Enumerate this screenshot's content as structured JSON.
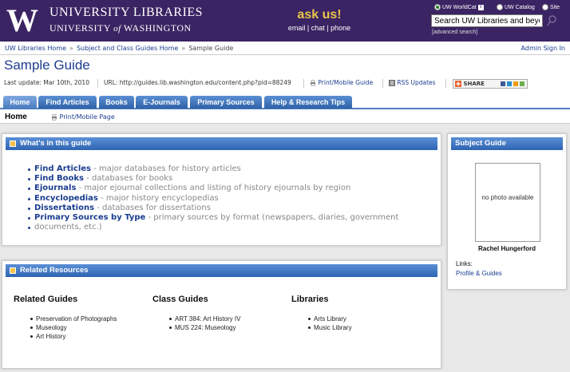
{
  "header": {
    "logo_letter": "W",
    "library_name": "UNIVERSITY LIBRARIES",
    "university_prefix": "UNIVERSITY",
    "university_of": "of",
    "university_suffix": "WASHINGTON",
    "ask_us": "ask us!",
    "ask_links": "email | chat | phone",
    "search_scopes": [
      {
        "label": "UW WorldCat",
        "selected": true
      },
      {
        "label": "UW Catalog",
        "selected": false
      },
      {
        "label": "Site",
        "selected": false
      }
    ],
    "info_badge": "i",
    "search_value": "Search UW Libraries and beyond",
    "advanced_search": "[advanced search]"
  },
  "breadcrumb": {
    "items": [
      "UW Libraries Home",
      "Subject and Class Guides Home",
      "Sample Guide"
    ],
    "separator": "»",
    "admin": "Admin Sign In"
  },
  "page": {
    "title": "Sample Guide",
    "last_update": "Last update: Mar 10th, 2010",
    "url": "URL: http://guides.lib.washington.edu/content.php?pid=88249",
    "print_mobile": "Print/Mobile Guide",
    "rss": "RSS Updates",
    "share": "SHARE"
  },
  "tabs": [
    {
      "label": "Home",
      "active": true
    },
    {
      "label": "Find Articles",
      "active": false
    },
    {
      "label": "Books",
      "active": false
    },
    {
      "label": "E-Journals",
      "active": false
    },
    {
      "label": "Primary Sources",
      "active": false
    },
    {
      "label": "Help & Research Tips",
      "active": false
    }
  ],
  "subbar": {
    "current": "Home",
    "print": "Print/Mobile Page"
  },
  "whats_in": {
    "title": "What's in this guide",
    "items": [
      {
        "link": "Find Articles",
        "desc": " -  major databases for history articles"
      },
      {
        "link": "Find Books",
        "desc": " -  databases for books"
      },
      {
        "link": "Ejournals",
        "desc": " - major ejournal collections and listing of history ejournals by region"
      },
      {
        "link": "Encyclopedias",
        "desc": " - major history encyclopedias"
      },
      {
        "link": "Dissertations",
        "desc": " - databases for dissertations"
      },
      {
        "link": "Primary Sources by Type",
        "desc": " - primary sources by format (newspapers, diaries, government"
      },
      {
        "link": "",
        "desc": "documents, etc.)"
      }
    ]
  },
  "related": {
    "title": "Related Resources",
    "guides_title": "Related Guides",
    "guides": [
      "Preservation of Photographs",
      "Museology",
      "Art History"
    ],
    "class_title": "Class Guides",
    "class_guides": [
      "ART 384: Art History IV",
      "MUS 224: Museology"
    ],
    "libraries_title": "Libraries",
    "libraries": [
      "Arts Library",
      "Music Library"
    ]
  },
  "subject_guide": {
    "title": "Subject Guide",
    "photo_text": "no photo available",
    "name": "Rachel Hungerford",
    "links_label": "Links:",
    "profile_link": "Profile & Guides"
  },
  "colors": {
    "header_bg": "#3b2463",
    "tab_blue": "#2f62a8",
    "link": "#1a3d8f",
    "ask_gold": "#e8c44a"
  }
}
